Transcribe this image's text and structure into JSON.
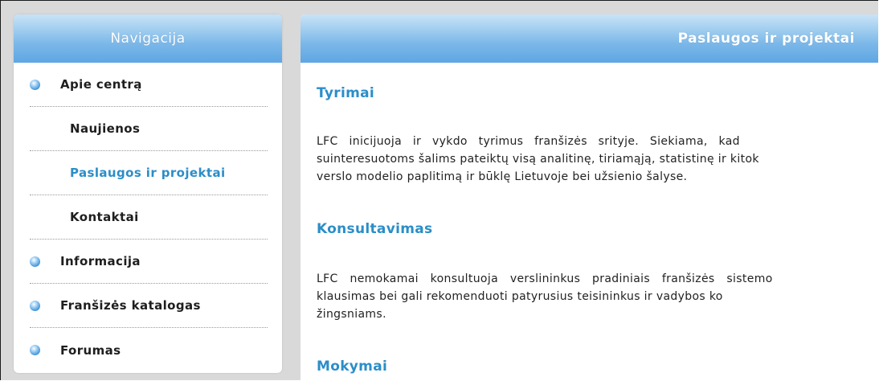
{
  "sidebar": {
    "title": "Navigacija",
    "items": [
      {
        "label": "Apie centrą",
        "level": "top",
        "active": false
      },
      {
        "label": "Naujienos",
        "level": "sub",
        "active": false
      },
      {
        "label": "Paslaugos ir projektai",
        "level": "sub",
        "active": true
      },
      {
        "label": "Kontaktai",
        "level": "sub",
        "active": false
      },
      {
        "label": "Informacija",
        "level": "top",
        "active": false
      },
      {
        "label": "Franšizės katalogas",
        "level": "top",
        "active": false
      },
      {
        "label": "Forumas",
        "level": "top",
        "active": false
      }
    ]
  },
  "main": {
    "title": "Paslaugos ir projektai",
    "sections": [
      {
        "title": "Tyrimai",
        "lines": [
          "LFC inicijuoja ir vykdo tyrimus franšizės srityje. Siekiama, kad",
          "suinteresuotoms šalims pateiktų visą analitinę, tiriamąją, statistinę ir kitok",
          "verslo modelio paplitimą ir būklę Lietuvoje bei užsienio šalyse."
        ]
      },
      {
        "title": "Konsultavimas",
        "lines": [
          "LFC nemokamai konsultuoja verslininkus pradiniais franšizės sistemo",
          "klausimas bei gali rekomenduoti patyrusius teisininkus ir vadybos ko",
          "žingsniams."
        ]
      },
      {
        "title": "Mokymai",
        "lines": []
      }
    ]
  },
  "colors": {
    "header_gradient_top": "#c9e3f7",
    "header_gradient_bottom": "#5ea6e3",
    "link_active": "#2b8ec8",
    "section_title": "#2b8ec8",
    "background": "#d9d9d9"
  },
  "icons": {
    "nav_bullet": "blue-sphere-bullet-icon"
  }
}
